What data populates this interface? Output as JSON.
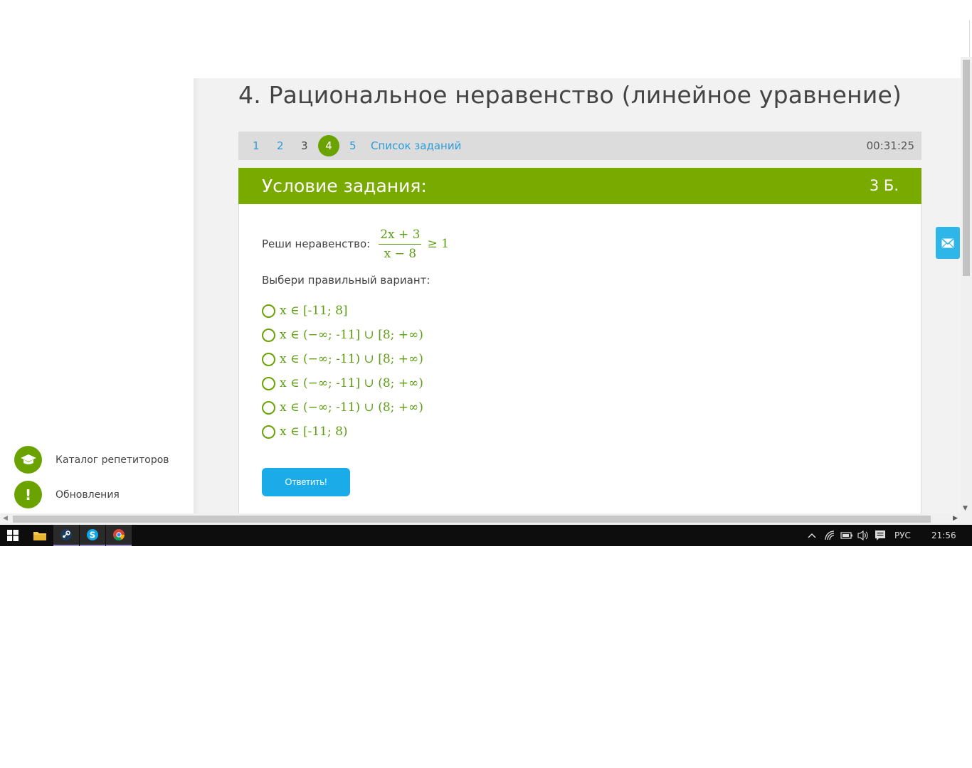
{
  "page": {
    "title": "4. Рациональное неравенство (линейное уравнение)"
  },
  "nav": {
    "items": [
      {
        "label": "1",
        "state": "link"
      },
      {
        "label": "2",
        "state": "link"
      },
      {
        "label": "3",
        "state": "plain"
      },
      {
        "label": "4",
        "state": "current"
      },
      {
        "label": "5",
        "state": "link"
      }
    ],
    "task_list_label": "Список заданий",
    "timer": "00:31:25"
  },
  "task": {
    "header_title": "Условие задания:",
    "points": "3 Б.",
    "question_label": "Реши неравенство:",
    "fraction_numerator": "2x + 3",
    "fraction_denominator": "x − 8",
    "rhs": "≥ 1",
    "choose_label": "Выбери правильный вариант:",
    "options": [
      "x ∈ [-11; 8]",
      "x ∈ (−∞; -11] ∪ [8; +∞)",
      "x ∈ (−∞; -11) ∪ [8; +∞)",
      "x ∈ (−∞; -11] ∪ (8; +∞)",
      "x ∈ (−∞; -11) ∪ (8; +∞)",
      "x ∈ [-11; 8)"
    ],
    "answer_button": "Ответить!"
  },
  "sidebar": {
    "links": [
      {
        "label": "Каталог репетиторов",
        "icon": "graduation-cap-icon"
      },
      {
        "label": "Обновления",
        "icon": "exclamation-icon",
        "glyph": "!"
      }
    ]
  },
  "taskbar": {
    "language": "РУС",
    "clock": "21:56"
  },
  "colors": {
    "accent_green": "#78aa00",
    "link_blue": "#2d9bd6",
    "button_blue": "#1aabe8",
    "math_green": "#5e9e14"
  }
}
